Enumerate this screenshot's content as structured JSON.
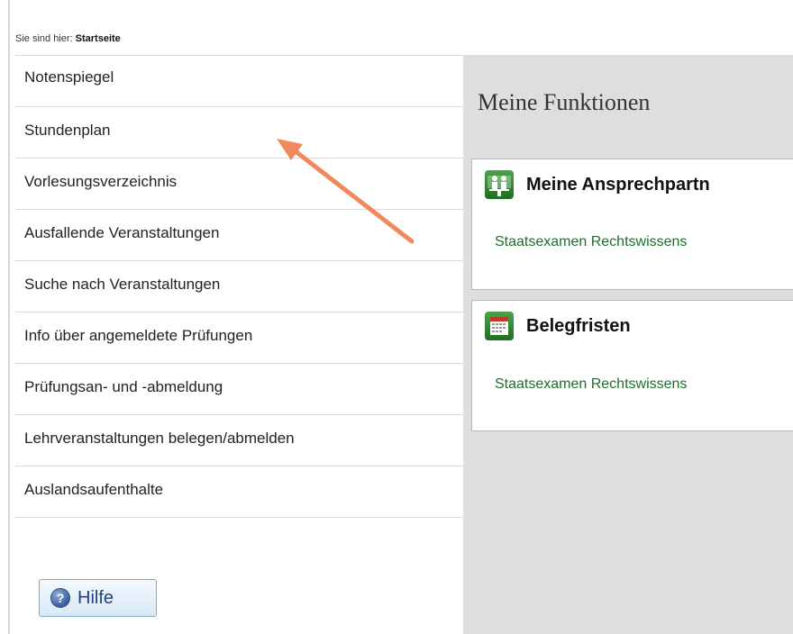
{
  "breadcrumb": {
    "prefix": "Sie sind hier:",
    "current": "Startseite"
  },
  "sidebar": {
    "items": [
      {
        "label": "Notenspiegel"
      },
      {
        "label": "Stundenplan"
      },
      {
        "label": "Vorlesungsverzeichnis"
      },
      {
        "label": "Ausfallende Veranstaltungen"
      },
      {
        "label": "Suche nach Veranstaltungen"
      },
      {
        "label": "Info über angemeldete Prüfungen"
      },
      {
        "label": "Prüfungsan- und -abmeldung"
      },
      {
        "label": "Lehrveranstaltungen belegen/abmelden"
      },
      {
        "label": "Auslandsaufenthalte"
      }
    ],
    "help_label": "Hilfe"
  },
  "main": {
    "title": "Meine Funktionen",
    "cards": [
      {
        "title": "Meine Ansprechpartn",
        "link": "Staatsexamen Rechtswissens",
        "icon": "people-icon"
      },
      {
        "title": "Belegfristen",
        "link": "Staatsexamen Rechtswissens",
        "icon": "calendar-icon"
      }
    ]
  },
  "annotation": {
    "color": "#f08a5d",
    "icon": "arrow-annotation"
  },
  "colors": {
    "link_green": "#1f6e2c",
    "icon_green": "#2e8b35",
    "panel_grey": "#dedede"
  }
}
